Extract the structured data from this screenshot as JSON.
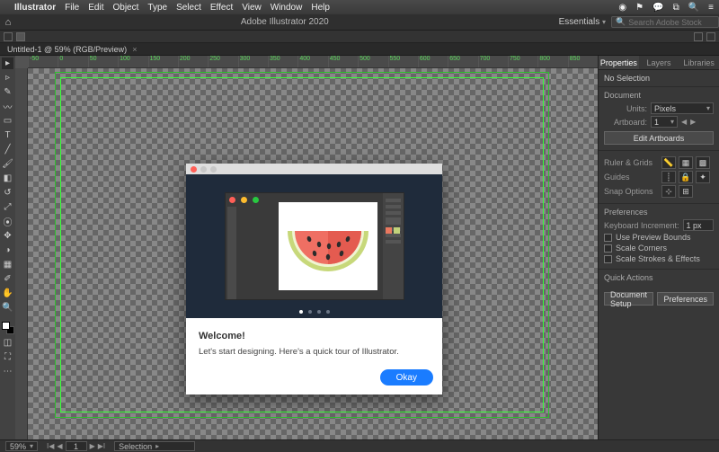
{
  "menubar": {
    "app": "Illustrator",
    "items": [
      "File",
      "Edit",
      "Object",
      "Type",
      "Select",
      "Effect",
      "View",
      "Window",
      "Help"
    ]
  },
  "app_header": {
    "home_icon": "⌂",
    "title": "Adobe Illustrator 2020",
    "workspace": "Essentials",
    "search_placeholder": "Search Adobe Stock"
  },
  "doc_tab": {
    "label": "Untitled-1 @ 59% (RGB/Preview)"
  },
  "ruler_ticks": [
    "-50",
    "0",
    "50",
    "100",
    "150",
    "200",
    "250",
    "300",
    "350",
    "400",
    "450",
    "500",
    "550",
    "600",
    "650",
    "700",
    "750",
    "800",
    "850"
  ],
  "tools": [
    "▸",
    "▹",
    "✎",
    "T",
    "╱",
    "□",
    "✂",
    "◔",
    "◐",
    "↺",
    "⤢",
    "🔍",
    "⋯"
  ],
  "right_panel": {
    "tabs": [
      "Properties",
      "Layers",
      "Libraries"
    ],
    "no_selection": "No Selection",
    "document": {
      "header": "Document",
      "units_label": "Units:",
      "units_value": "Pixels",
      "artboard_label": "Artboard:",
      "artboard_value": "1",
      "edit_artboards": "Edit Artboards"
    },
    "ruler_grids": "Ruler & Grids",
    "guides": "Guides",
    "snap_options": "Snap Options",
    "preferences": {
      "header": "Preferences",
      "kb_inc_label": "Keyboard Increment:",
      "kb_inc_value": "1 px",
      "use_preview_bounds": "Use Preview Bounds",
      "scale_corners": "Scale Corners",
      "scale_strokes": "Scale Strokes & Effects"
    },
    "quick_actions": {
      "header": "Quick Actions",
      "doc_setup": "Document Setup",
      "prefs": "Preferences"
    }
  },
  "status": {
    "zoom": "59%",
    "nav": "1",
    "selection_label": "Selection"
  },
  "modal": {
    "title": "Welcome!",
    "body": "Let's start designing. Here's a quick tour of Illustrator.",
    "ok": "Okay"
  }
}
